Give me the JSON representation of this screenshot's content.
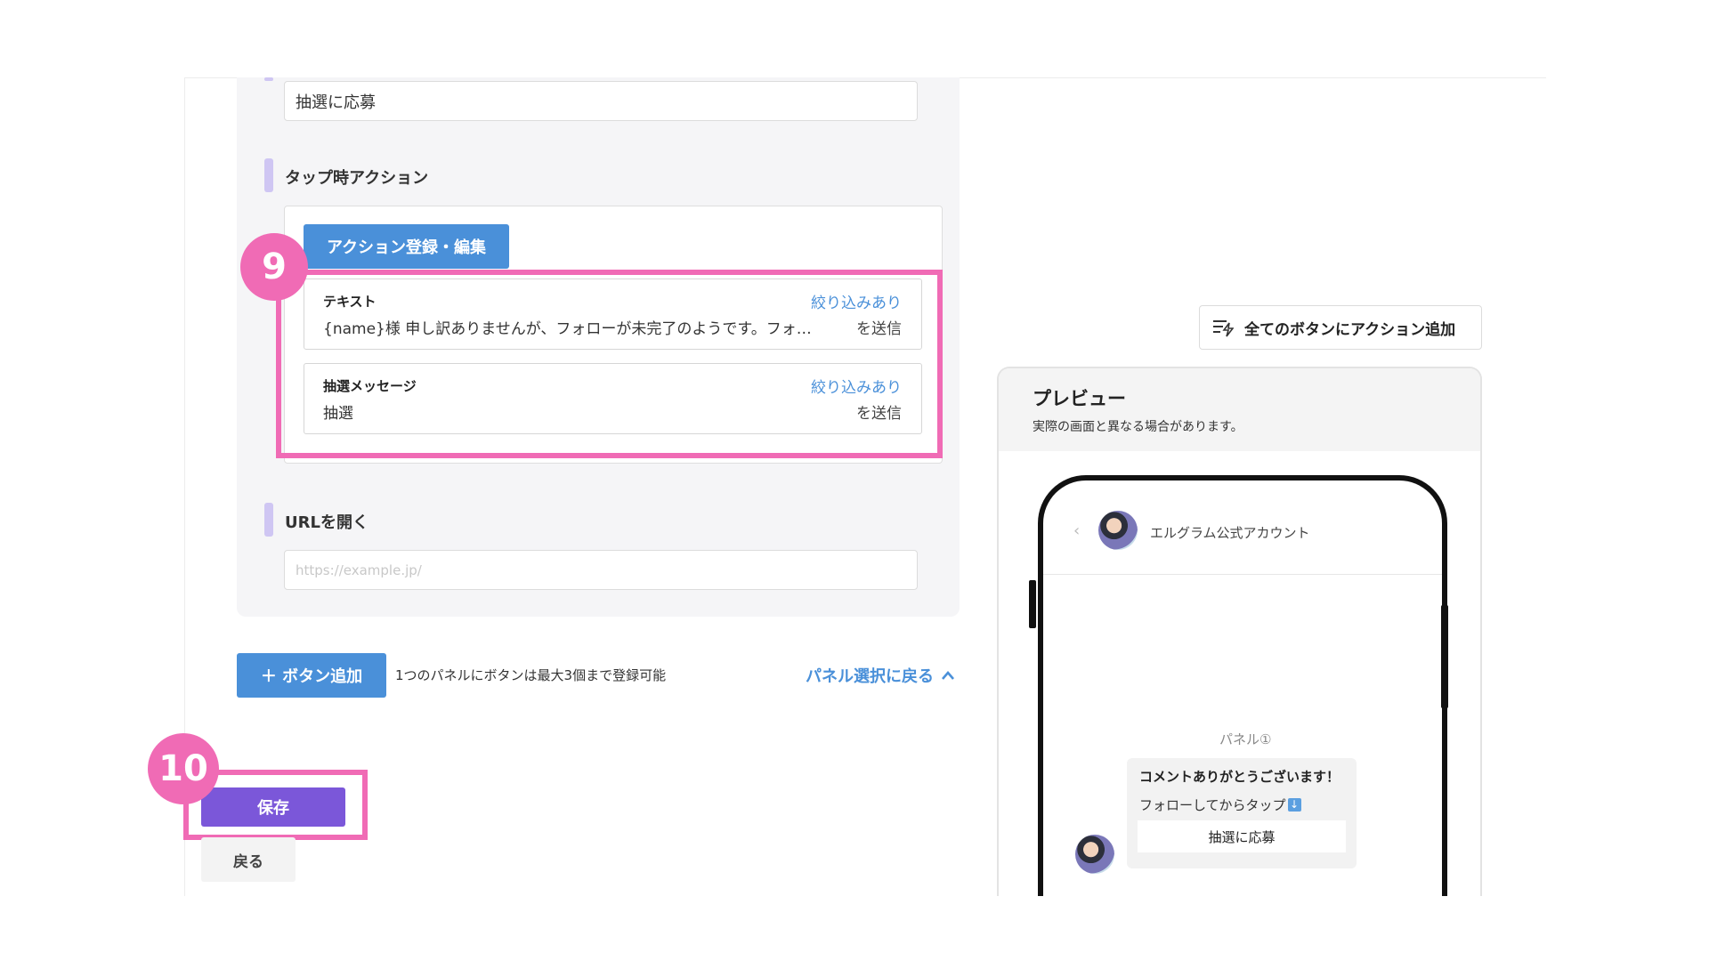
{
  "form": {
    "button_label_value": "抽選に応募",
    "tap_action_title": "タップ時アクション",
    "action_edit_button": "アクション登録・編集",
    "actions": [
      {
        "title": "テキスト",
        "filter": "絞り込みあり",
        "body": "{name}様 申し訳ありませんが、フォローが未完了のようです。フォ…",
        "send": "を送信"
      },
      {
        "title": "抽選メッセージ",
        "filter": "絞り込みあり",
        "body": "抽選",
        "send": "を送信"
      }
    ],
    "url_title": "URLを開く",
    "url_placeholder": "https://example.jp/",
    "add_button": "＋ ボタン追加",
    "add_note": "1つのパネルにボタンは最大3個まで登録可能",
    "back_to_panel": "パネル選択に戻る",
    "save_button": "保存",
    "back_button": "戻る"
  },
  "annotations": {
    "step9": "9",
    "step10": "10"
  },
  "toolbar": {
    "add_action_all": "全てのボタンにアクション追加"
  },
  "preview": {
    "title": "プレビュー",
    "subtitle": "実際の画面と異なる場合があります。",
    "account_name": "エルグラム公式アカウント",
    "panel_label": "パネル①",
    "message_title": "コメントありがとうございます！",
    "message_sub": "フォローしてからタップ",
    "message_button": "抽選に応募"
  },
  "colors": {
    "accent_blue": "#4a90d9",
    "save_purple": "#7b57d9",
    "annotation_pink": "#f06bb5",
    "section_bar": "#cfc6f3"
  }
}
